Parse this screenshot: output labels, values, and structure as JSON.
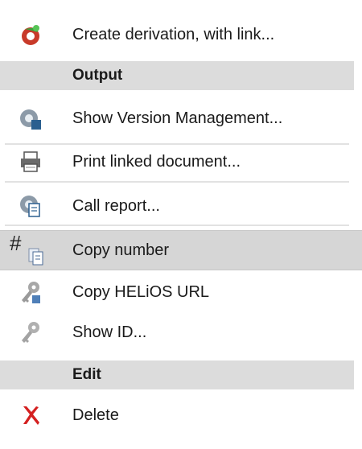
{
  "menu": {
    "items": [
      {
        "label": "Create derivation, with link...",
        "icon": "create-derivation-icon"
      },
      {
        "label": "Output",
        "type": "header"
      },
      {
        "label": "Show Version Management...",
        "icon": "version-management-icon"
      },
      {
        "label": "Print linked document...",
        "icon": "printer-icon"
      },
      {
        "label": "Call report...",
        "icon": "report-icon"
      },
      {
        "label": "Copy number",
        "icon": "copy-number-icon",
        "selected": true
      },
      {
        "label": "Copy HELiOS URL",
        "icon": "key-url-icon"
      },
      {
        "label": "Show ID...",
        "icon": "key-icon"
      },
      {
        "label": "Edit",
        "type": "header"
      },
      {
        "label": "Delete",
        "icon": "delete-icon"
      }
    ]
  },
  "colors": {
    "header_bg": "#dcdcdc",
    "selected_bg": "#d6d6d6",
    "delete_red": "#d42020"
  }
}
